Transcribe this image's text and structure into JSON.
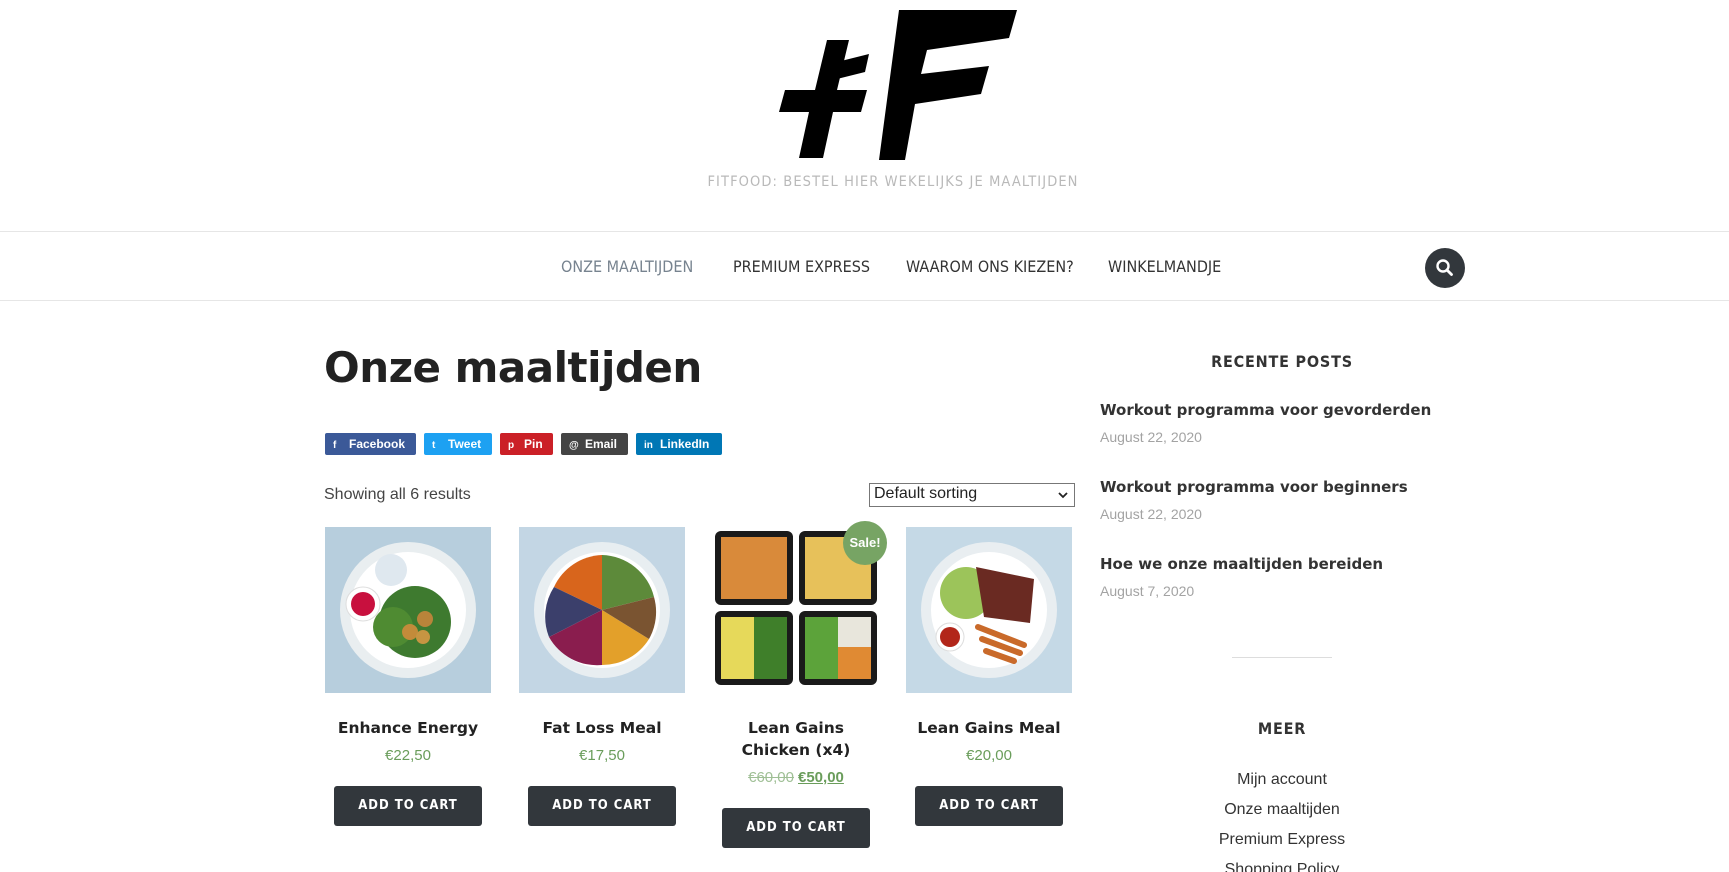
{
  "header": {
    "logo": "FF",
    "tagline": "FITFOOD: BESTEL HIER WEKELIJKS JE MAALTIJDEN"
  },
  "nav": {
    "items": [
      {
        "label": "ONZE MAALTIJDEN",
        "active": true
      },
      {
        "label": "PREMIUM EXPRESS",
        "active": false
      },
      {
        "label": "WAAROM ONS KIEZEN?",
        "active": false
      },
      {
        "label": "WINKELMANDJE",
        "active": false
      }
    ],
    "search_icon": "search-icon"
  },
  "page": {
    "title": "Onze maaltijden"
  },
  "share": [
    {
      "label": "Facebook",
      "icon": "f",
      "color": "#3b5998"
    },
    {
      "label": "Tweet",
      "icon": "t",
      "color": "#1da1f2"
    },
    {
      "label": "Pin",
      "icon": "p",
      "color": "#cb2027"
    },
    {
      "label": "Email",
      "icon": "@",
      "color": "#444444"
    },
    {
      "label": "LinkedIn",
      "icon": "in",
      "color": "#0077b5"
    }
  ],
  "shop": {
    "result_count": "Showing all 6 results",
    "sorting": "Default sorting",
    "products": [
      {
        "name": "Enhance Energy",
        "price": "€22,50",
        "button": "ADD TO CART"
      },
      {
        "name": "Fat Loss Meal",
        "price": "€17,50",
        "button": "ADD TO CART"
      },
      {
        "name": "Lean Gains Chicken (x4)",
        "old_price": "€60,00",
        "price": "€50,00",
        "sale_badge": "Sale!",
        "button": "ADD TO CART"
      },
      {
        "name": "Lean Gains Meal",
        "price": "€20,00",
        "button": "ADD TO CART"
      }
    ]
  },
  "sidebar": {
    "recent_title": "RECENTE POSTS",
    "posts": [
      {
        "title": "Workout programma voor gevorderden",
        "date": "August 22, 2020"
      },
      {
        "title": "Workout programma voor beginners",
        "date": "August 22, 2020"
      },
      {
        "title": "Hoe we onze maaltijden bereiden",
        "date": "August 7, 2020"
      }
    ],
    "meer_title": "MEER",
    "meer_links": [
      "Mijn account",
      "Onze maaltijden",
      "Premium Express",
      "Shopping Policy"
    ]
  },
  "colors": {
    "accent_green": "#77a464",
    "button_dark": "#32373c",
    "price_green": "#6a9d5b"
  }
}
